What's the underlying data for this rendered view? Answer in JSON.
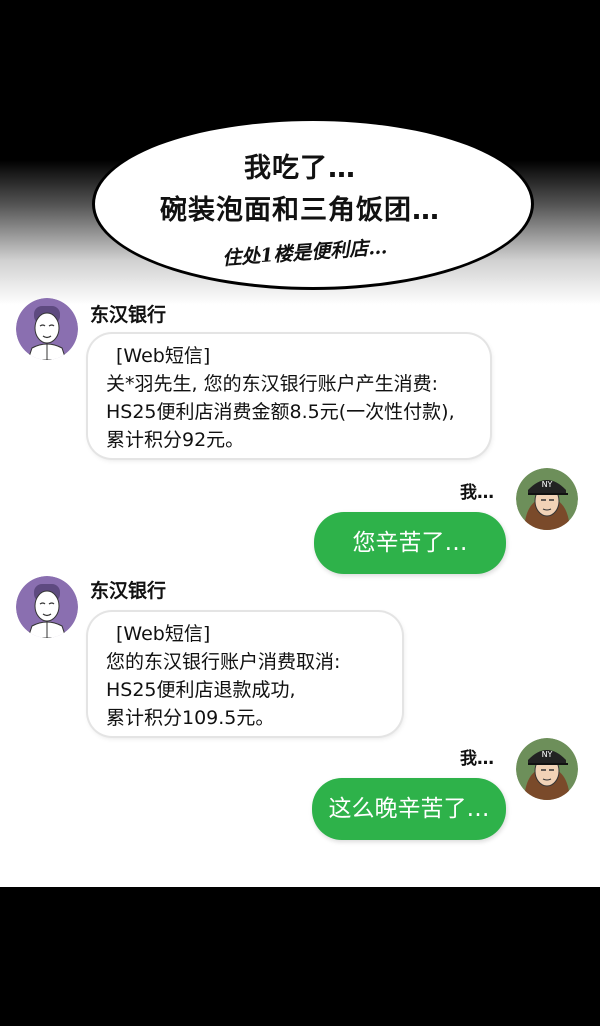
{
  "thought": {
    "line1": "我吃了…",
    "line2": "碗装泡面和三角饭团…",
    "handwritten_note": "住处1楼是便利店…"
  },
  "messages": [
    {
      "sender": "东汉银行",
      "tag": "[Web短信]",
      "lines": [
        "关*羽先生, 您的东汉银行账户产生消费:",
        "HS25便利店消费金额8.5元(一次性付款),",
        "累计积分92元。"
      ],
      "reply_label": "我…",
      "reply": "您辛苦了…"
    },
    {
      "sender": "东汉银行",
      "tag": "[Web短信]",
      "lines": [
        "您的东汉银行账户消费取消:",
        "HS25便利店退款成功,",
        "累计积分109.5元。"
      ],
      "reply_label": "我…",
      "reply": "这么晚辛苦了…"
    }
  ],
  "colors": {
    "reply_bubble": "#2eb24a",
    "bank_avatar_bg": "#8a6fb0",
    "page_bg": "#ffffff",
    "frame": "#000000"
  },
  "icons": {
    "bank_avatar": "bank-avatar-icon",
    "user_avatar": "user-avatar-icon"
  }
}
